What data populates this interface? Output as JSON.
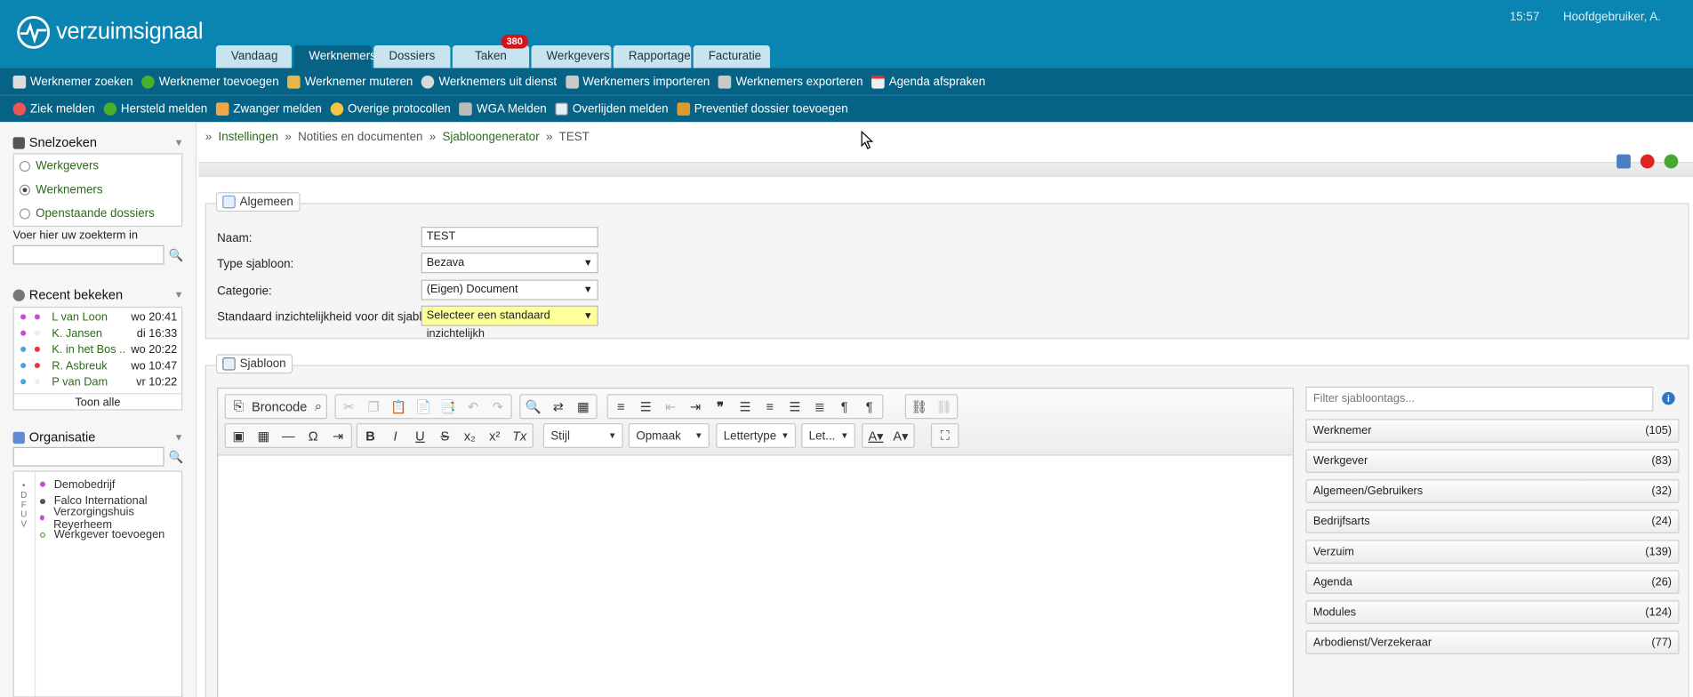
{
  "app": {
    "name": "verzuimsignaal",
    "time": "15:57",
    "user": "Hoofdgebruiker, A."
  },
  "tabs": [
    {
      "label": "Vandaag"
    },
    {
      "label": "Werknemers"
    },
    {
      "label": "Dossiers"
    },
    {
      "label": "Taken",
      "badge": "380"
    },
    {
      "label": "Werkgevers"
    },
    {
      "label": "Rapportage"
    },
    {
      "label": "Facturatie"
    }
  ],
  "toolbar1": [
    "Werknemer zoeken",
    "Werknemer toevoegen",
    "Werknemer muteren",
    "Werknemers uit dienst",
    "Werknemers importeren",
    "Werknemers exporteren",
    "Agenda afspraken"
  ],
  "toolbar2": [
    "Ziek melden",
    "Hersteld melden",
    "Zwanger melden",
    "Overige protocollen",
    "WGA Melden",
    "Overlijden melden",
    "Preventief dossier toevoegen"
  ],
  "quick": {
    "title": "Snelzoeken",
    "options": [
      "Werkgevers",
      "Werknemers",
      "Openstaande dossiers"
    ],
    "selected": "Werknemers",
    "label": "Voer hier uw zoekterm in"
  },
  "recent": {
    "title": "Recent bekeken",
    "items": [
      {
        "name": "L van Loon",
        "time": "wo 20:41"
      },
      {
        "name": "K. Jansen",
        "time": "di 16:33"
      },
      {
        "name": "K. in het Bos ..",
        "time": "wo 20:22"
      },
      {
        "name": "R. Asbreuk",
        "time": "wo 10:47"
      },
      {
        "name": "P van Dam",
        "time": "vr 10:22"
      }
    ],
    "show_all": "Toon alle"
  },
  "org": {
    "title": "Organisatie",
    "letters": "• D F U V",
    "items": [
      "Demobedrijf",
      "Falco International",
      "Verzorgingshuis Reyerheem",
      "Werkgever toevoegen"
    ]
  },
  "breadcrumb": [
    "Instellingen",
    "Notities en documenten",
    "Sjabloongenerator",
    "TEST"
  ],
  "general": {
    "legend": "Algemeen",
    "name_label": "Naam:",
    "name_value": "TEST",
    "type_label": "Type sjabloon:",
    "type_value": "Bezava",
    "cat_label": "Categorie:",
    "cat_value": "(Eigen) Document",
    "vis_label": "Standaard inzichtelijkheid voor dit sjabloon:",
    "vis_value": "Selecteer een standaard inzichtelijkh"
  },
  "template": {
    "legend": "Sjabloon",
    "source_btn": "Broncode",
    "style": "Stijl",
    "format": "Opmaak",
    "font": "Lettertype",
    "size": "Let...",
    "filter_placeholder": "Filter sjabloontags..."
  },
  "tags": [
    {
      "name": "Werknemer",
      "count": "(105)"
    },
    {
      "name": "Werkgever",
      "count": "(83)"
    },
    {
      "name": "Algemeen/Gebruikers",
      "count": "(32)"
    },
    {
      "name": "Bedrijfsarts",
      "count": "(24)"
    },
    {
      "name": "Verzuim",
      "count": "(139)"
    },
    {
      "name": "Agenda",
      "count": "(26)"
    },
    {
      "name": "Modules",
      "count": "(124)"
    },
    {
      "name": "Arbodienst/Verzekeraar",
      "count": "(77)"
    }
  ]
}
